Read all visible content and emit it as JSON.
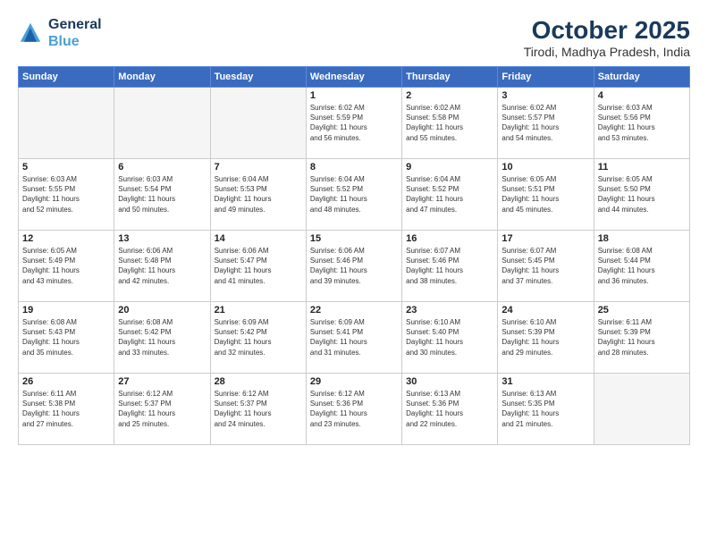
{
  "header": {
    "logo_line1": "General",
    "logo_line2": "Blue",
    "month": "October 2025",
    "location": "Tirodi, Madhya Pradesh, India"
  },
  "weekdays": [
    "Sunday",
    "Monday",
    "Tuesday",
    "Wednesday",
    "Thursday",
    "Friday",
    "Saturday"
  ],
  "weeks": [
    [
      {
        "day": "",
        "info": ""
      },
      {
        "day": "",
        "info": ""
      },
      {
        "day": "",
        "info": ""
      },
      {
        "day": "1",
        "info": "Sunrise: 6:02 AM\nSunset: 5:59 PM\nDaylight: 11 hours\nand 56 minutes."
      },
      {
        "day": "2",
        "info": "Sunrise: 6:02 AM\nSunset: 5:58 PM\nDaylight: 11 hours\nand 55 minutes."
      },
      {
        "day": "3",
        "info": "Sunrise: 6:02 AM\nSunset: 5:57 PM\nDaylight: 11 hours\nand 54 minutes."
      },
      {
        "day": "4",
        "info": "Sunrise: 6:03 AM\nSunset: 5:56 PM\nDaylight: 11 hours\nand 53 minutes."
      }
    ],
    [
      {
        "day": "5",
        "info": "Sunrise: 6:03 AM\nSunset: 5:55 PM\nDaylight: 11 hours\nand 52 minutes."
      },
      {
        "day": "6",
        "info": "Sunrise: 6:03 AM\nSunset: 5:54 PM\nDaylight: 11 hours\nand 50 minutes."
      },
      {
        "day": "7",
        "info": "Sunrise: 6:04 AM\nSunset: 5:53 PM\nDaylight: 11 hours\nand 49 minutes."
      },
      {
        "day": "8",
        "info": "Sunrise: 6:04 AM\nSunset: 5:52 PM\nDaylight: 11 hours\nand 48 minutes."
      },
      {
        "day": "9",
        "info": "Sunrise: 6:04 AM\nSunset: 5:52 PM\nDaylight: 11 hours\nand 47 minutes."
      },
      {
        "day": "10",
        "info": "Sunrise: 6:05 AM\nSunset: 5:51 PM\nDaylight: 11 hours\nand 45 minutes."
      },
      {
        "day": "11",
        "info": "Sunrise: 6:05 AM\nSunset: 5:50 PM\nDaylight: 11 hours\nand 44 minutes."
      }
    ],
    [
      {
        "day": "12",
        "info": "Sunrise: 6:05 AM\nSunset: 5:49 PM\nDaylight: 11 hours\nand 43 minutes."
      },
      {
        "day": "13",
        "info": "Sunrise: 6:06 AM\nSunset: 5:48 PM\nDaylight: 11 hours\nand 42 minutes."
      },
      {
        "day": "14",
        "info": "Sunrise: 6:06 AM\nSunset: 5:47 PM\nDaylight: 11 hours\nand 41 minutes."
      },
      {
        "day": "15",
        "info": "Sunrise: 6:06 AM\nSunset: 5:46 PM\nDaylight: 11 hours\nand 39 minutes."
      },
      {
        "day": "16",
        "info": "Sunrise: 6:07 AM\nSunset: 5:46 PM\nDaylight: 11 hours\nand 38 minutes."
      },
      {
        "day": "17",
        "info": "Sunrise: 6:07 AM\nSunset: 5:45 PM\nDaylight: 11 hours\nand 37 minutes."
      },
      {
        "day": "18",
        "info": "Sunrise: 6:08 AM\nSunset: 5:44 PM\nDaylight: 11 hours\nand 36 minutes."
      }
    ],
    [
      {
        "day": "19",
        "info": "Sunrise: 6:08 AM\nSunset: 5:43 PM\nDaylight: 11 hours\nand 35 minutes."
      },
      {
        "day": "20",
        "info": "Sunrise: 6:08 AM\nSunset: 5:42 PM\nDaylight: 11 hours\nand 33 minutes."
      },
      {
        "day": "21",
        "info": "Sunrise: 6:09 AM\nSunset: 5:42 PM\nDaylight: 11 hours\nand 32 minutes."
      },
      {
        "day": "22",
        "info": "Sunrise: 6:09 AM\nSunset: 5:41 PM\nDaylight: 11 hours\nand 31 minutes."
      },
      {
        "day": "23",
        "info": "Sunrise: 6:10 AM\nSunset: 5:40 PM\nDaylight: 11 hours\nand 30 minutes."
      },
      {
        "day": "24",
        "info": "Sunrise: 6:10 AM\nSunset: 5:39 PM\nDaylight: 11 hours\nand 29 minutes."
      },
      {
        "day": "25",
        "info": "Sunrise: 6:11 AM\nSunset: 5:39 PM\nDaylight: 11 hours\nand 28 minutes."
      }
    ],
    [
      {
        "day": "26",
        "info": "Sunrise: 6:11 AM\nSunset: 5:38 PM\nDaylight: 11 hours\nand 27 minutes."
      },
      {
        "day": "27",
        "info": "Sunrise: 6:12 AM\nSunset: 5:37 PM\nDaylight: 11 hours\nand 25 minutes."
      },
      {
        "day": "28",
        "info": "Sunrise: 6:12 AM\nSunset: 5:37 PM\nDaylight: 11 hours\nand 24 minutes."
      },
      {
        "day": "29",
        "info": "Sunrise: 6:12 AM\nSunset: 5:36 PM\nDaylight: 11 hours\nand 23 minutes."
      },
      {
        "day": "30",
        "info": "Sunrise: 6:13 AM\nSunset: 5:36 PM\nDaylight: 11 hours\nand 22 minutes."
      },
      {
        "day": "31",
        "info": "Sunrise: 6:13 AM\nSunset: 5:35 PM\nDaylight: 11 hours\nand 21 minutes."
      },
      {
        "day": "",
        "info": ""
      }
    ]
  ]
}
